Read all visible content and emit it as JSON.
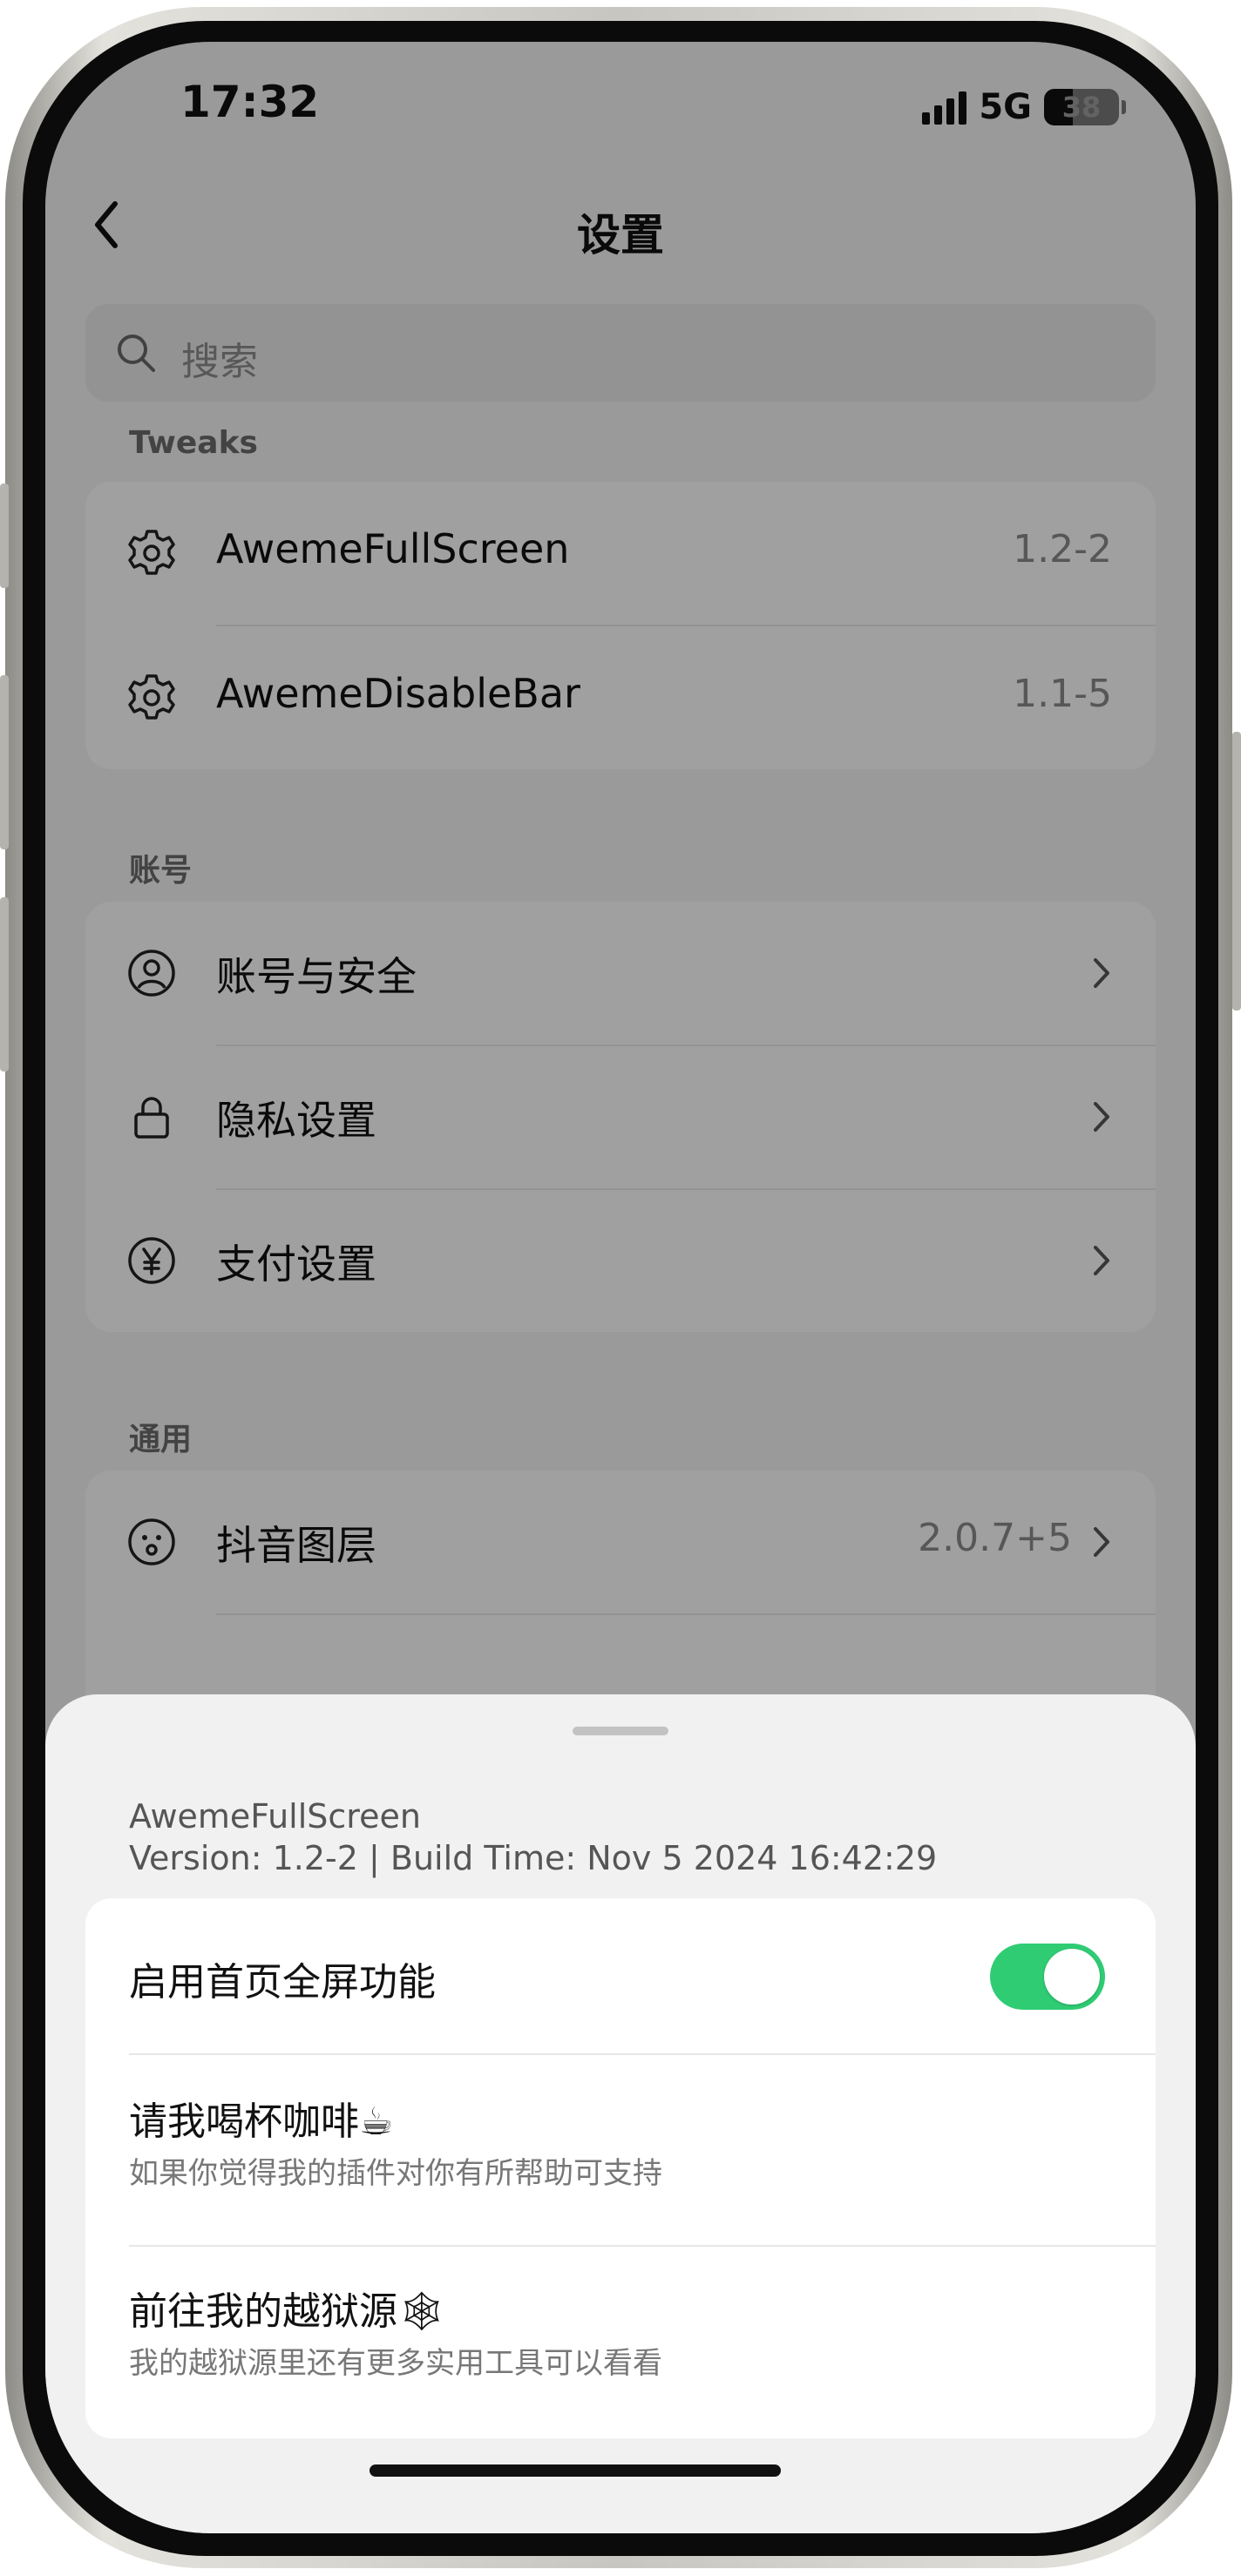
{
  "status_bar": {
    "time": "17:32",
    "network": "5G",
    "battery": "38",
    "battery_level": 0.38
  },
  "header": {
    "title": "设置",
    "back_icon": "chevron-left-icon"
  },
  "search": {
    "placeholder": "搜索"
  },
  "sections": {
    "tweaks": {
      "label": "Tweaks",
      "items": [
        {
          "label": "AwemeFullScreen",
          "value": "1.2-2",
          "icon": "gear-icon"
        },
        {
          "label": "AwemeDisableBar",
          "value": "1.1-5",
          "icon": "gear-icon"
        }
      ]
    },
    "account": {
      "label": "账号",
      "items": [
        {
          "label": "账号与安全",
          "icon": "user-circle-icon"
        },
        {
          "label": "隐私设置",
          "icon": "lock-icon"
        },
        {
          "label": "支付设置",
          "icon": "yen-circle-icon"
        }
      ]
    },
    "general": {
      "label": "通用",
      "items": [
        {
          "label": "抖音图层",
          "value": "2.0.7+5",
          "icon": "face-icon"
        }
      ]
    }
  },
  "sheet": {
    "name": "AwemeFullScreen",
    "version_line": "Version: 1.2-2 | Build Time: Nov  5 2024 16:42:29",
    "options": [
      {
        "title": "启用首页全屏功能",
        "toggle_on": true,
        "accent": "#2fcc74"
      },
      {
        "title": "请我喝杯咖啡☕",
        "subtitle": "如果你觉得我的插件对你有所帮助可支持"
      },
      {
        "title": "前往我的越狱源🕸",
        "subtitle": "我的越狱源里还有更多实用工具可以看看"
      }
    ]
  }
}
